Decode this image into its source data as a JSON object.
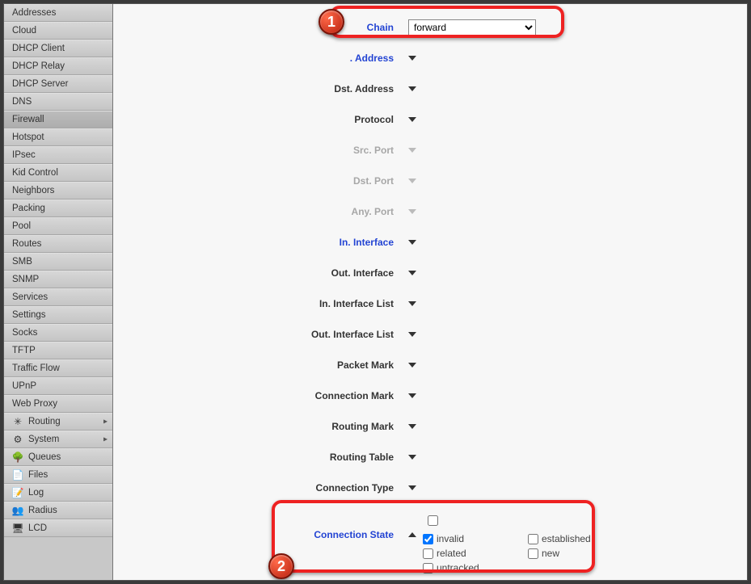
{
  "sidebar": {
    "items": [
      {
        "label": "Addresses",
        "icon": "",
        "sub": false,
        "arrow": false,
        "active": false
      },
      {
        "label": "Cloud",
        "icon": "",
        "sub": false,
        "arrow": false,
        "active": false
      },
      {
        "label": "DHCP Client",
        "icon": "",
        "sub": false,
        "arrow": false,
        "active": false
      },
      {
        "label": "DHCP Relay",
        "icon": "",
        "sub": false,
        "arrow": false,
        "active": false
      },
      {
        "label": "DHCP Server",
        "icon": "",
        "sub": false,
        "arrow": false,
        "active": false
      },
      {
        "label": "DNS",
        "icon": "",
        "sub": false,
        "arrow": false,
        "active": false
      },
      {
        "label": "Firewall",
        "icon": "",
        "sub": false,
        "arrow": false,
        "active": true
      },
      {
        "label": "Hotspot",
        "icon": "",
        "sub": false,
        "arrow": false,
        "active": false
      },
      {
        "label": "IPsec",
        "icon": "",
        "sub": false,
        "arrow": false,
        "active": false
      },
      {
        "label": "Kid Control",
        "icon": "",
        "sub": false,
        "arrow": false,
        "active": false
      },
      {
        "label": "Neighbors",
        "icon": "",
        "sub": false,
        "arrow": false,
        "active": false
      },
      {
        "label": "Packing",
        "icon": "",
        "sub": false,
        "arrow": false,
        "active": false
      },
      {
        "label": "Pool",
        "icon": "",
        "sub": false,
        "arrow": false,
        "active": false
      },
      {
        "label": "Routes",
        "icon": "",
        "sub": false,
        "arrow": false,
        "active": false
      },
      {
        "label": "SMB",
        "icon": "",
        "sub": false,
        "arrow": false,
        "active": false
      },
      {
        "label": "SNMP",
        "icon": "",
        "sub": false,
        "arrow": false,
        "active": false
      },
      {
        "label": "Services",
        "icon": "",
        "sub": false,
        "arrow": false,
        "active": false
      },
      {
        "label": "Settings",
        "icon": "",
        "sub": false,
        "arrow": false,
        "active": false
      },
      {
        "label": "Socks",
        "icon": "",
        "sub": false,
        "arrow": false,
        "active": false
      },
      {
        "label": "TFTP",
        "icon": "",
        "sub": false,
        "arrow": false,
        "active": false
      },
      {
        "label": "Traffic Flow",
        "icon": "",
        "sub": false,
        "arrow": false,
        "active": false
      },
      {
        "label": "UPnP",
        "icon": "",
        "sub": false,
        "arrow": false,
        "active": false
      },
      {
        "label": "Web Proxy",
        "icon": "",
        "sub": false,
        "arrow": false,
        "active": false
      },
      {
        "label": "Routing",
        "icon": "✳",
        "sub": false,
        "arrow": true,
        "active": false
      },
      {
        "label": "System",
        "icon": "⚙",
        "sub": false,
        "arrow": true,
        "active": false
      },
      {
        "label": "Queues",
        "icon": "🌳",
        "sub": false,
        "arrow": false,
        "active": false
      },
      {
        "label": "Files",
        "icon": "📄",
        "sub": false,
        "arrow": false,
        "active": false
      },
      {
        "label": "Log",
        "icon": "📝",
        "sub": false,
        "arrow": false,
        "active": false
      },
      {
        "label": "Radius",
        "icon": "👥",
        "sub": false,
        "arrow": false,
        "active": false
      },
      {
        "label": "LCD",
        "icon": "🖥",
        "sub": false,
        "arrow": false,
        "active": false
      }
    ]
  },
  "form": {
    "rows": [
      {
        "key": "chain",
        "label": "Chain",
        "highlight": true,
        "disabled": false,
        "type": "select",
        "value": "forward"
      },
      {
        "key": "src_address",
        "label": ". Address",
        "highlight": true,
        "disabled": false,
        "type": "expand"
      },
      {
        "key": "dst_address",
        "label": "Dst. Address",
        "highlight": false,
        "disabled": false,
        "type": "expand"
      },
      {
        "key": "protocol",
        "label": "Protocol",
        "highlight": false,
        "disabled": false,
        "type": "expand"
      },
      {
        "key": "src_port",
        "label": "Src. Port",
        "highlight": false,
        "disabled": true,
        "type": "expand"
      },
      {
        "key": "dst_port",
        "label": "Dst. Port",
        "highlight": false,
        "disabled": true,
        "type": "expand"
      },
      {
        "key": "any_port",
        "label": "Any. Port",
        "highlight": false,
        "disabled": true,
        "type": "expand"
      },
      {
        "key": "in_interface",
        "label": "In. Interface",
        "highlight": true,
        "disabled": false,
        "type": "expand"
      },
      {
        "key": "out_interface",
        "label": "Out. Interface",
        "highlight": false,
        "disabled": false,
        "type": "expand"
      },
      {
        "key": "in_interface_list",
        "label": "In. Interface List",
        "highlight": false,
        "disabled": false,
        "type": "expand"
      },
      {
        "key": "out_interface_list",
        "label": "Out. Interface List",
        "highlight": false,
        "disabled": false,
        "type": "expand"
      },
      {
        "key": "packet_mark",
        "label": "Packet Mark",
        "highlight": false,
        "disabled": false,
        "type": "expand"
      },
      {
        "key": "connection_mark",
        "label": "Connection Mark",
        "highlight": false,
        "disabled": false,
        "type": "expand"
      },
      {
        "key": "routing_mark",
        "label": "Routing Mark",
        "highlight": false,
        "disabled": false,
        "type": "expand"
      },
      {
        "key": "routing_table",
        "label": "Routing Table",
        "highlight": false,
        "disabled": false,
        "type": "expand"
      },
      {
        "key": "connection_type",
        "label": "Connection Type",
        "highlight": false,
        "disabled": false,
        "type": "expand"
      }
    ],
    "connection_state": {
      "label": "Connection State",
      "options": [
        {
          "label": "invalid",
          "checked": true
        },
        {
          "label": "established",
          "checked": false
        },
        {
          "label": "related",
          "checked": false
        },
        {
          "label": "new",
          "checked": false
        },
        {
          "label": "untracked",
          "checked": false
        }
      ]
    },
    "chain_options": [
      "forward"
    ]
  },
  "callouts": {
    "c1": "1",
    "c2": "2"
  }
}
